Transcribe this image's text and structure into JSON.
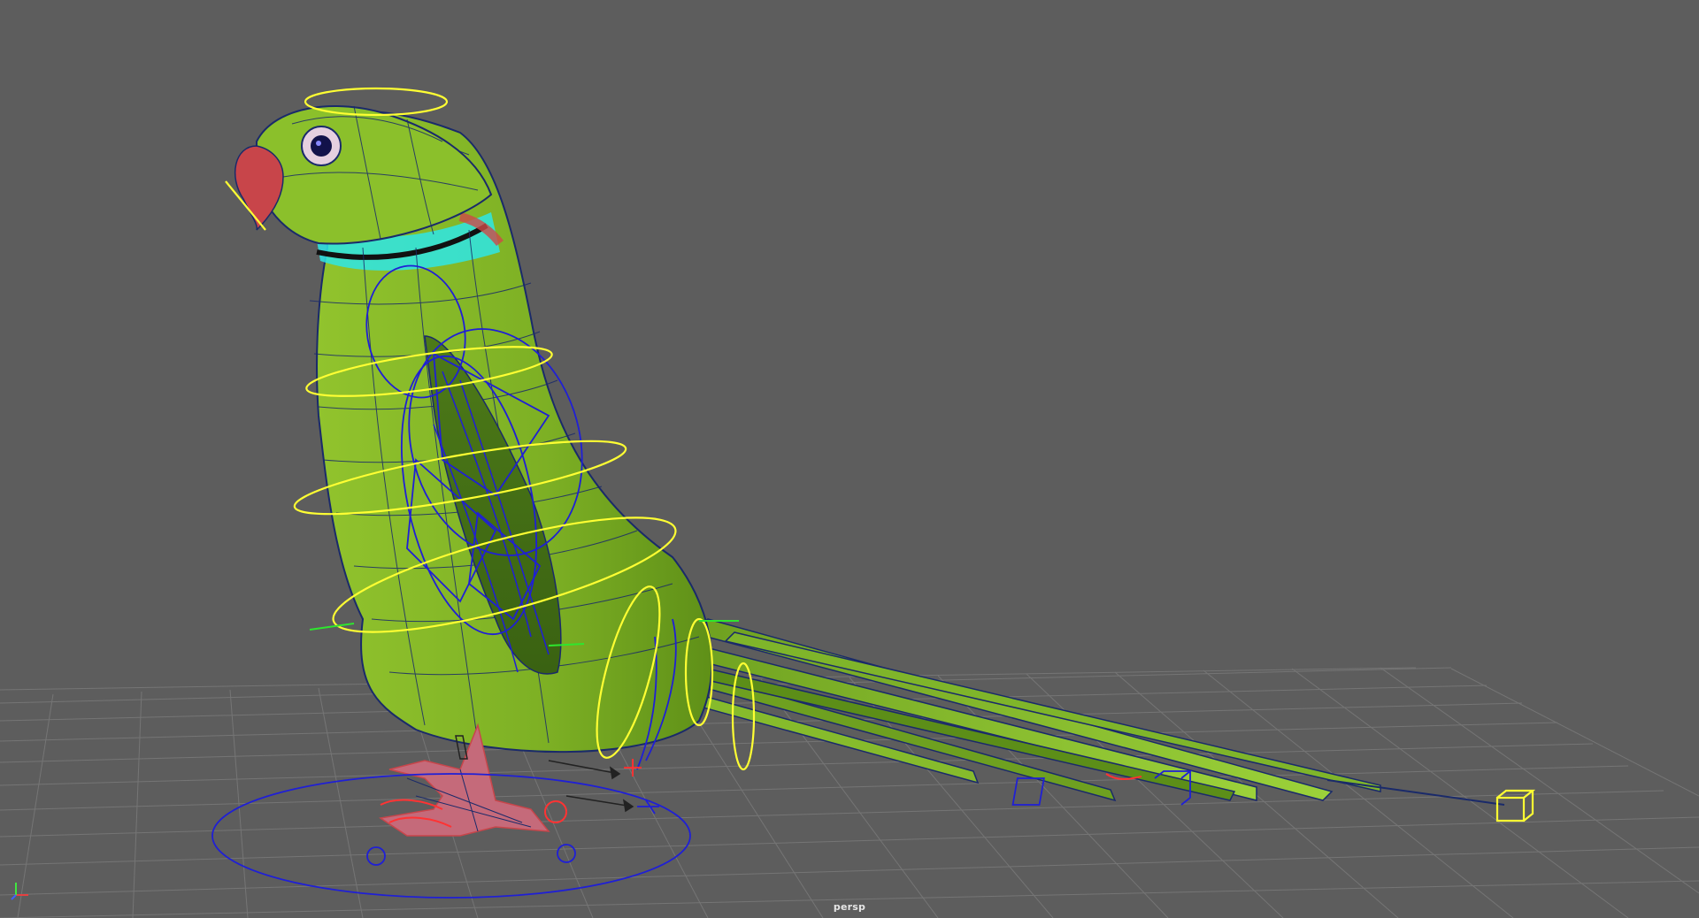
{
  "viewport": {
    "camera_name": "persp",
    "background_color": "#5d5d5d",
    "grid_color": "#7a7a7a"
  },
  "scene": {
    "subject": "parrot-rig",
    "mesh_color": "#7fb52a",
    "wireframe_color": "#1a2a6a",
    "nurbs_control_color": "#ffff33",
    "ik_control_color": "#1f1fd6",
    "foot_control_color": "#ff3333",
    "body_color_accent": "#2ee6e6",
    "beak_color": "#c8454a"
  },
  "axis_gizmo": {
    "icon": "xyz-axis-icon"
  }
}
